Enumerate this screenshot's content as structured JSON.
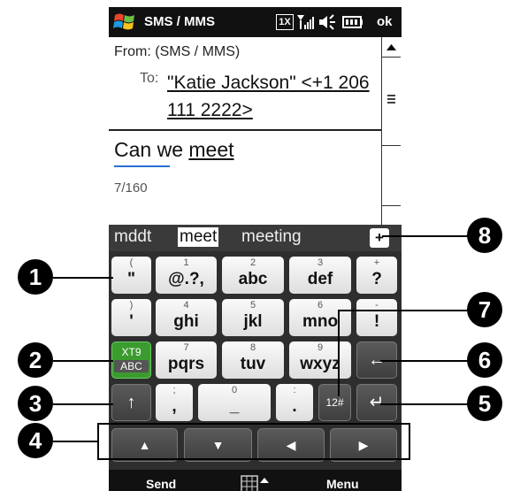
{
  "status": {
    "app_title": "SMS / MMS",
    "network_badge": "1X",
    "ok_label": "ok",
    "icons": [
      "windows-logo-icon",
      "network-1x-icon",
      "signal-icon",
      "speaker-icon",
      "battery-icon"
    ]
  },
  "message": {
    "from_label": "From:",
    "from_value": "(SMS / MMS)",
    "to_label": "To:",
    "to_value": "\"Katie Jackson\" <+1 206 111 2222>",
    "body_before": "Can we ",
    "body_word": "meet",
    "char_count": "7/160"
  },
  "suggestions": [
    "mddt",
    "meet",
    "meeting"
  ],
  "suggestion_plus": "+",
  "keyboard": {
    "rows": [
      [
        {
          "small": "(",
          "main": "\""
        },
        {
          "small": "1",
          "main": "@.?,"
        },
        {
          "small": "2",
          "main": "abc"
        },
        {
          "small": "3",
          "main": "def"
        },
        {
          "small": "+",
          "main": "?"
        }
      ],
      [
        {
          "small": ")",
          "main": "'"
        },
        {
          "small": "4",
          "main": "ghi"
        },
        {
          "small": "5",
          "main": "jkl"
        },
        {
          "small": "6",
          "main": "mno"
        },
        {
          "small": "-",
          "main": "!"
        }
      ],
      [
        {
          "small": "7",
          "main": "pqrs"
        },
        {
          "small": "8",
          "main": "tuv"
        },
        {
          "small": "9",
          "main": "wxyz"
        }
      ],
      [
        {
          "small": ";",
          "main": ","
        },
        {
          "small": "0",
          "main": "_"
        },
        {
          "small": ":",
          "main": "."
        }
      ]
    ],
    "xt9_top": "XT9",
    "xt9_bottom": "ABC",
    "num_key": "12#",
    "backspace": "←",
    "enter": "↵",
    "shift": "↑",
    "arrows": [
      "▲",
      "▼",
      "◀",
      "▶"
    ]
  },
  "softkeys": {
    "left": "Send",
    "right": "Menu"
  },
  "callouts": [
    "1",
    "2",
    "3",
    "4",
    "5",
    "6",
    "7",
    "8"
  ],
  "colors": {
    "xt9_green": "#3c9b2f",
    "accent_blue": "#2a6fd6",
    "dark_key": "#4a4a4a"
  }
}
